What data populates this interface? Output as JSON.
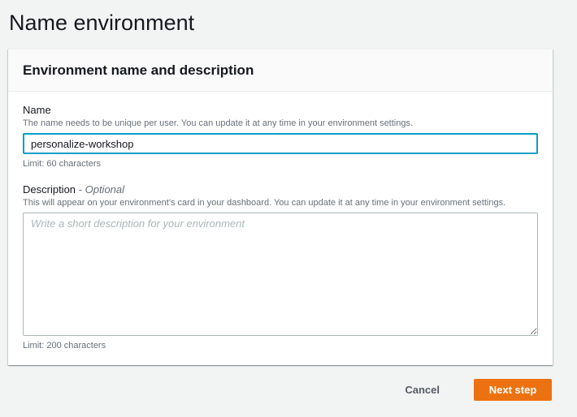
{
  "page": {
    "title": "Name environment"
  },
  "panel": {
    "title": "Environment name and description"
  },
  "name_field": {
    "label": "Name",
    "description": "The name needs to be unique per user. You can update it at any time in your environment settings.",
    "value": "personalize-workshop",
    "constraint": "Limit: 60 characters"
  },
  "description_field": {
    "label": "Description",
    "optional_label": "- Optional",
    "description": "This will appear on your environment’s card in your dashboard. You can update it at any time in your environment settings.",
    "placeholder": "Write a short description for your environment",
    "constraint": "Limit: 200 characters"
  },
  "actions": {
    "cancel_label": "Cancel",
    "next_label": "Next step"
  },
  "colors": {
    "primary_button": "#ec7211",
    "focus_border": "#0a9dc4",
    "page_background": "#f2f3f3"
  }
}
